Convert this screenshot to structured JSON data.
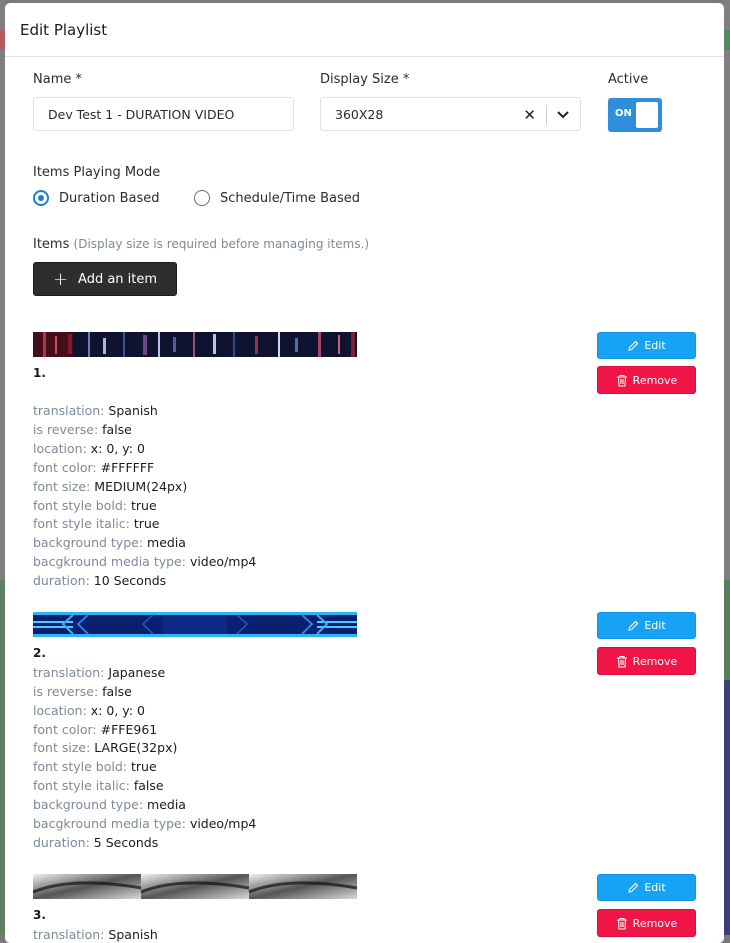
{
  "modal": {
    "title": "Edit Playlist"
  },
  "form": {
    "name_label": "Name *",
    "name_value": "Dev Test 1 - DURATION VIDEO",
    "display_size_label": "Display Size *",
    "display_size_value": "360X28",
    "active_label": "Active",
    "active_toggle_text": "ON",
    "mode_label": "Items Playing Mode",
    "mode_options": [
      {
        "label": "Duration Based",
        "selected": true
      },
      {
        "label": "Schedule/Time Based",
        "selected": false
      }
    ],
    "items_label": "Items",
    "items_hint": "(Display size is required before managing items.)",
    "add_item_label": "Add an item"
  },
  "items": [
    {
      "number": "1.",
      "props": [
        {
          "key": "translation:",
          "value": "Spanish"
        },
        {
          "key": "is reverse:",
          "value": "false"
        },
        {
          "key": "location:",
          "value": "x: 0, y: 0"
        },
        {
          "key": "font color:",
          "value": "#FFFFFF"
        },
        {
          "key": "font size:",
          "value": "MEDIUM(24px)"
        },
        {
          "key": "font style bold:",
          "value": "true"
        },
        {
          "key": "font style italic:",
          "value": "true"
        },
        {
          "key": "background type:",
          "value": "media"
        },
        {
          "key": "bacgkround media type:",
          "value": "video/mp4"
        },
        {
          "key": "duration:",
          "value": "10 Seconds"
        }
      ]
    },
    {
      "number": "2.",
      "props": [
        {
          "key": "translation:",
          "value": "Japanese"
        },
        {
          "key": "is reverse:",
          "value": "false"
        },
        {
          "key": "location:",
          "value": "x: 0, y: 0"
        },
        {
          "key": "font color:",
          "value": "#FFE961"
        },
        {
          "key": "font size:",
          "value": "LARGE(32px)"
        },
        {
          "key": "font style bold:",
          "value": "true"
        },
        {
          "key": "font style italic:",
          "value": "false"
        },
        {
          "key": "background type:",
          "value": "media"
        },
        {
          "key": "bacgkround media type:",
          "value": "video/mp4"
        },
        {
          "key": "duration:",
          "value": "5 Seconds"
        }
      ]
    },
    {
      "number": "3.",
      "props": [
        {
          "key": "translation:",
          "value": "Spanish"
        }
      ]
    }
  ],
  "buttons": {
    "edit_label": "Edit",
    "remove_label": "Remove"
  },
  "colors": {
    "primary": "#1c7ed6",
    "edit": "#16a3f5",
    "remove": "#f01546",
    "dark": "#2e2e2e"
  }
}
